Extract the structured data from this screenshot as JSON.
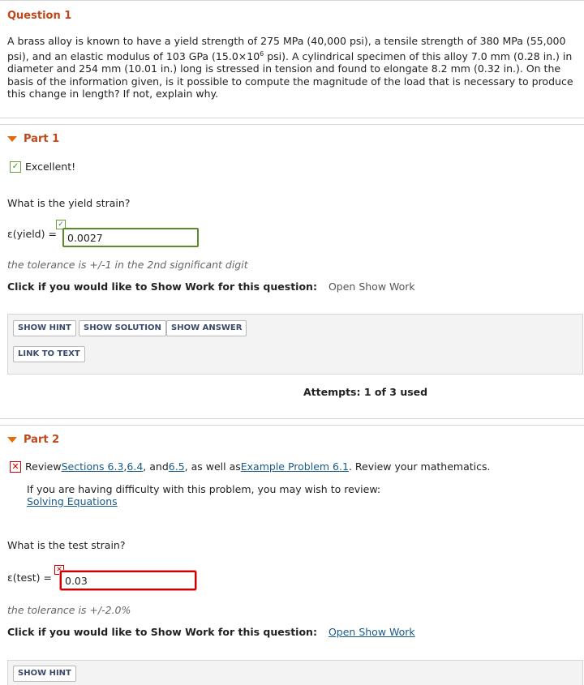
{
  "question": {
    "title": "Question 1",
    "text": "A brass alloy is known to have a yield strength of 275 MPa (40,000 psi), a tensile strength of 380 MPa (55,000 psi), and an elastic modulus of 103 GPa (15.0×10",
    "text_sup": "6",
    "text_rest": " psi). A cylindrical specimen of this alloy 7.0 mm (0.28 in.) in diameter and 254 mm (10.01 in.) long is stressed in tension and found to elongate 8.2 mm (0.32 in.). On the basis of the information given, is it possible to compute the magnitude of the load that is necessary to produce this change in length? If not, explain why."
  },
  "part1": {
    "title": "Part 1",
    "feedback": "Excellent!",
    "prompt": "What is the yield strain?",
    "answer_label": "ε(yield) =",
    "answer_value": "0.0027",
    "tolerance": "the tolerance is +/-1 in the 2nd significant digit",
    "showwork_text": "Click if you would like to Show Work for this question:",
    "showwork_link": "Open Show Work",
    "buttons": {
      "hint": "SHOW HINT",
      "solution": "SHOW SOLUTION",
      "answer": "SHOW ANSWER",
      "link": "LINK TO TEXT"
    },
    "attempts": "Attempts: 1 of 3 used"
  },
  "part2": {
    "title": "Part 2",
    "review_prefix": "Review",
    "link_sections": "Sections 6.3",
    "comma": ",",
    "link_64": "6.4",
    "and_text": ", and",
    "link_65": "6.5",
    "as_well_as": ", as well as",
    "link_example": "Example Problem 6.1",
    "review_suffix": ". Review your mathematics.",
    "difficulty_text": "If you are having difficulty with this problem, you may wish to review:",
    "link_solving": "Solving Equations",
    "prompt": "What is the test strain?",
    "answer_label": "ε(test) =",
    "answer_value": "0.03",
    "tolerance": "the tolerance is +/-2.0%",
    "showwork_text": "Click if you would like to Show Work for this question:",
    "showwork_link": "Open Show Work",
    "buttons": {
      "hint": "SHOW HINT"
    }
  },
  "colors": {
    "accent": "#c0471a",
    "correct": "#5a8a2a",
    "wrong": "#cc0000",
    "link": "#1a5a8a"
  },
  "icons": {
    "collapse": "triangle-down-icon",
    "correct": "checkmark-icon",
    "incorrect": "x-mark-icon"
  }
}
